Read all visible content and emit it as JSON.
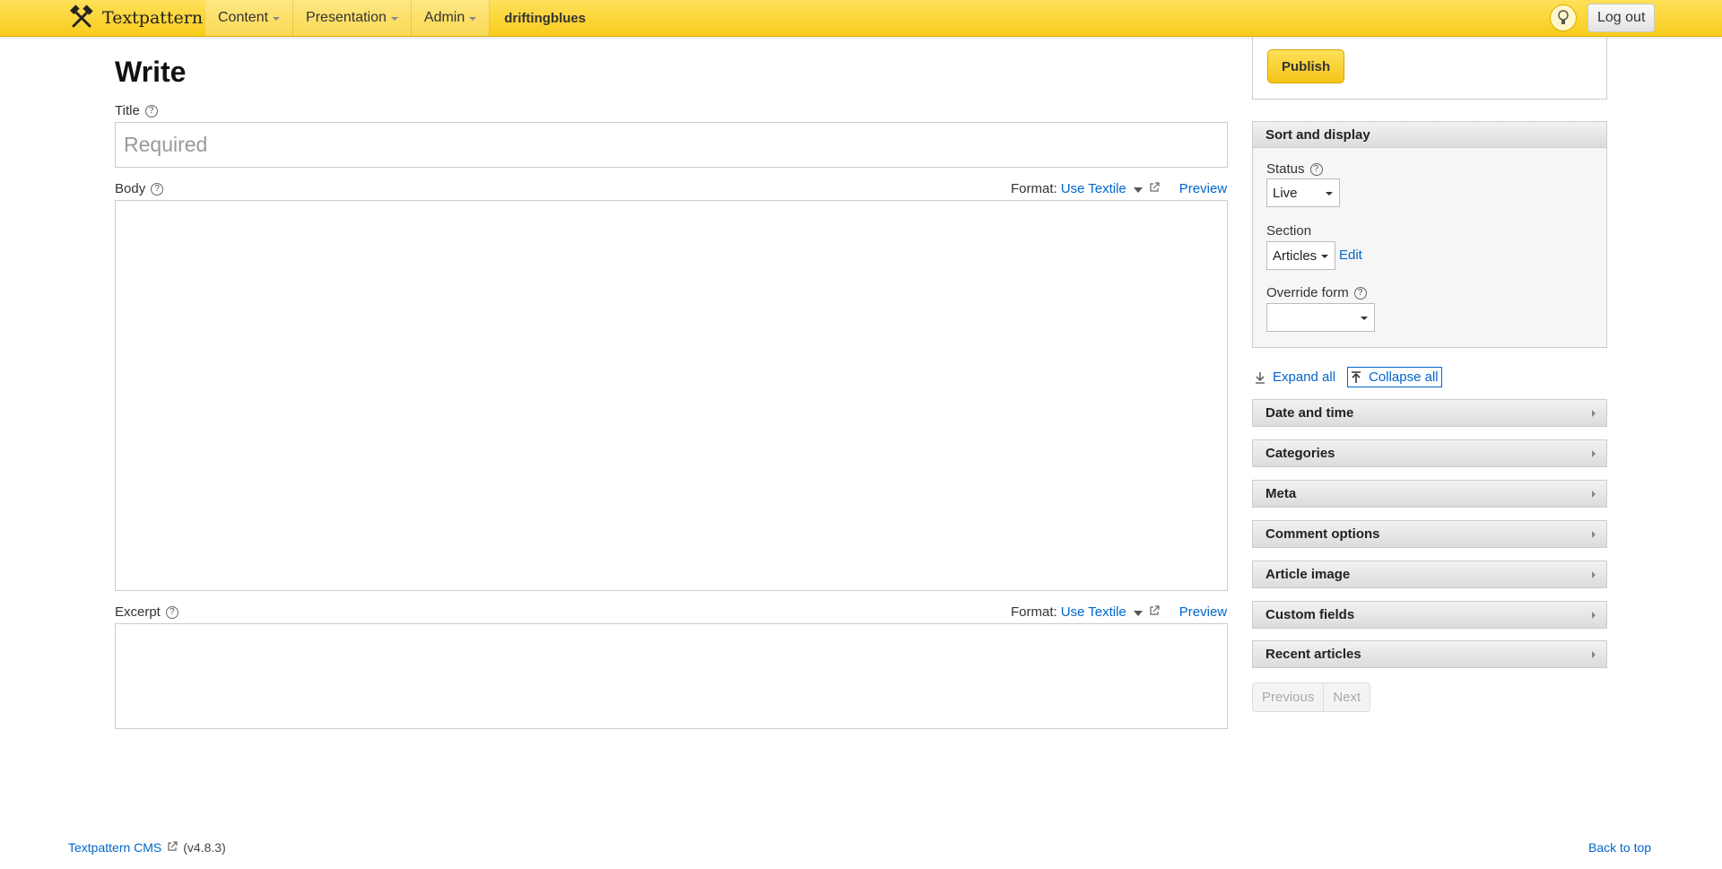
{
  "topbar": {
    "brand": "Textpattern",
    "nav": [
      {
        "label": "Content"
      },
      {
        "label": "Presentation"
      },
      {
        "label": "Admin"
      }
    ],
    "site_name": "driftingblues",
    "logout_label": "Log out"
  },
  "main": {
    "page_title": "Write",
    "title_label": "Title",
    "title_placeholder": "Required",
    "body_label": "Body",
    "excerpt_label": "Excerpt",
    "format_label": "Format:",
    "format_value": "Use Textile",
    "preview_label": "Preview"
  },
  "sidebar": {
    "publish_label": "Publish",
    "sort_display": {
      "heading": "Sort and display",
      "status_label": "Status",
      "status_value": "Live",
      "section_label": "Section",
      "section_value": "Articles",
      "section_edit": "Edit",
      "override_label": "Override form",
      "override_value": ""
    },
    "expand_all": "Expand all",
    "collapse_all": "Collapse all",
    "panels": [
      "Date and time",
      "Categories",
      "Meta",
      "Comment options",
      "Article image",
      "Custom fields",
      "Recent articles"
    ],
    "pager": {
      "previous": "Previous",
      "next": "Next"
    }
  },
  "footer": {
    "cms_link": "Textpattern CMS",
    "version": "(v4.8.3)",
    "back_to_top": "Back to top"
  },
  "colors": {
    "topbar": "#f8cc1b",
    "link": "#0066cc",
    "publish": "#f5c516"
  }
}
